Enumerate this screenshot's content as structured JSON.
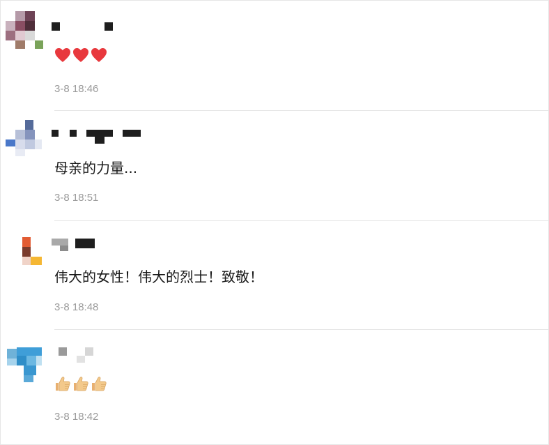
{
  "comments": [
    {
      "reactions": [
        "heart-icon",
        "heart-icon",
        "heart-icon"
      ],
      "text": "",
      "time": "3-8 18:46"
    },
    {
      "reactions": [],
      "text": "母亲的力量...",
      "time": "3-8 18:51"
    },
    {
      "reactions": [],
      "text": "伟大的女性！伟大的烈士！致敬！",
      "time": "3-8 18:48"
    },
    {
      "reactions": [
        "thumbs-up-icon",
        "thumbs-up-icon",
        "thumbs-up-icon"
      ],
      "text": "",
      "time": "3-8 18:42"
    }
  ],
  "colors": {
    "heart": "#e8383d",
    "thumb": "#f3c98b",
    "timestamp": "#9b9b9b",
    "divider": "#e5e5e5"
  }
}
